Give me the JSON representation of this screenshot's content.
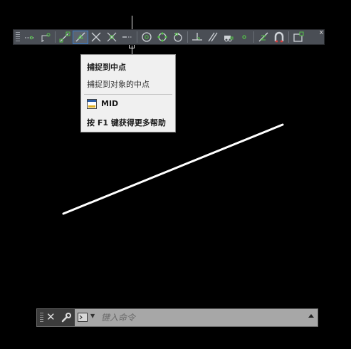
{
  "toolbar": {
    "buttons": [
      {
        "icon": "temporary-track-icon"
      },
      {
        "icon": "snap-from-icon"
      },
      {
        "icon": "endpoint-icon"
      },
      {
        "icon": "midpoint-icon",
        "active": true
      },
      {
        "icon": "intersection-icon"
      },
      {
        "icon": "apparent-intersection-icon"
      },
      {
        "icon": "extension-icon"
      },
      {
        "icon": "center-icon"
      },
      {
        "icon": "quadrant-icon"
      },
      {
        "icon": "tangent-icon"
      },
      {
        "icon": "perpendicular-icon"
      },
      {
        "icon": "parallel-icon"
      },
      {
        "icon": "insert-icon"
      },
      {
        "icon": "node-icon"
      },
      {
        "icon": "nearest-icon"
      },
      {
        "icon": "snap-none-icon"
      },
      {
        "icon": "osnap-settings-icon"
      }
    ],
    "close_label": "x"
  },
  "tooltip": {
    "title": "捕捉到中点",
    "description": "捕捉到对象的中点",
    "command": "MID",
    "help": "按 F1 键获得更多帮助"
  },
  "command_line": {
    "placeholder": "键入命令"
  },
  "colors": {
    "background": "#000000",
    "line": "#ffffff",
    "toolbar": "#4a4e55",
    "tooltip_bg": "#f0f0f0",
    "command_bar": "#a7a7a7"
  }
}
